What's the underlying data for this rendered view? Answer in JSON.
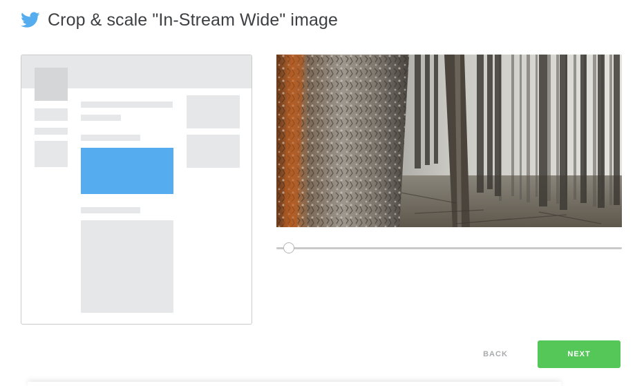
{
  "header": {
    "title": "Crop & scale \"In-Stream Wide\" image",
    "icon": "twitter-bird-icon",
    "icon_color": "#55acee"
  },
  "preview": {
    "highlight_color": "#55acee",
    "placeholder_color": "#e6e7e8"
  },
  "image": {
    "subject": "forest-trunk-photo"
  },
  "zoom_slider": {
    "value": 0.02
  },
  "actions": {
    "back_label": "BACK",
    "next_label": "NEXT",
    "next_color": "#55c758"
  }
}
